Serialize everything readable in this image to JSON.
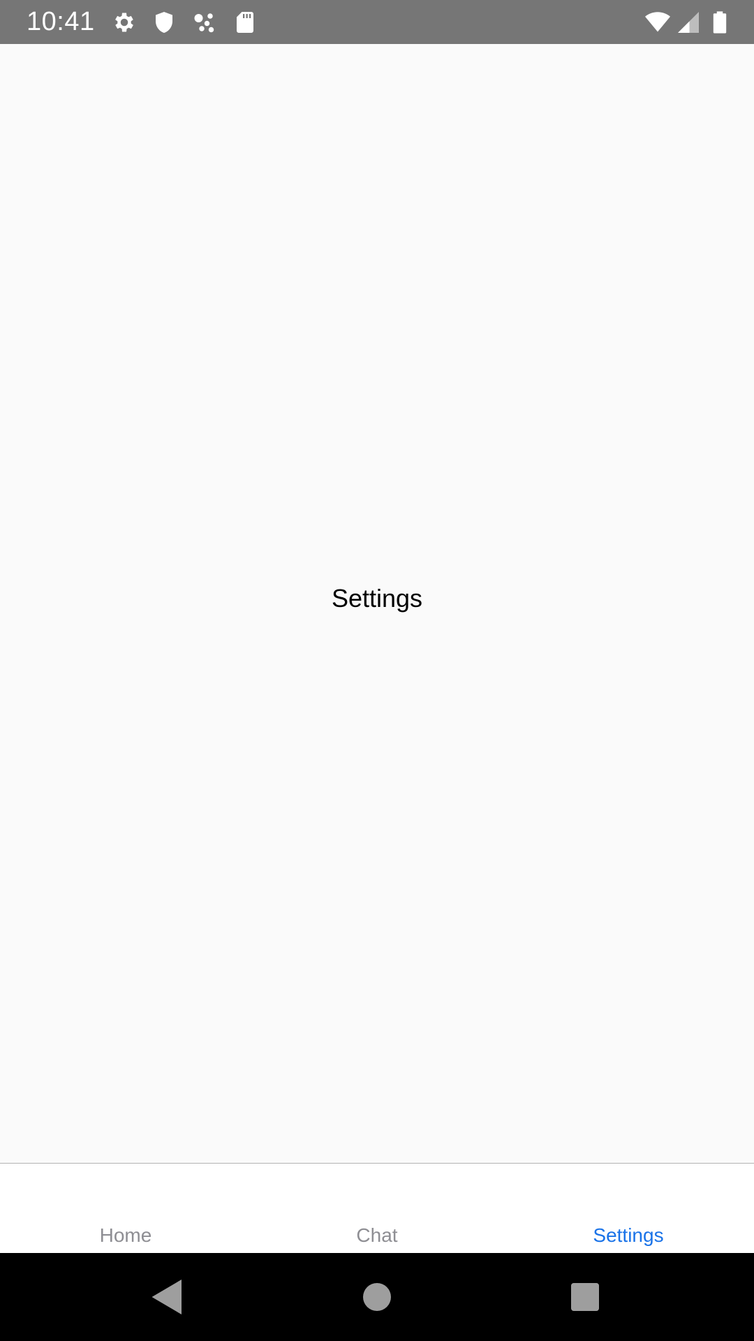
{
  "status_bar": {
    "time": "10:41",
    "icons": [
      "gear-icon",
      "shield-icon",
      "share-dots-icon",
      "sd-card-icon",
      "wifi-icon",
      "signal-icon",
      "battery-icon"
    ],
    "background": "#767676"
  },
  "content": {
    "title": "Settings"
  },
  "tab_bar": {
    "active_color": "#1a73e8",
    "inactive_color": "#8e8e93",
    "active_tab": "Settings",
    "tabs": [
      {
        "label": "Home"
      },
      {
        "label": "Chat"
      },
      {
        "label": "Settings"
      }
    ]
  },
  "nav_bar": {
    "buttons": [
      "back-icon",
      "home-icon",
      "recents-icon"
    ]
  }
}
